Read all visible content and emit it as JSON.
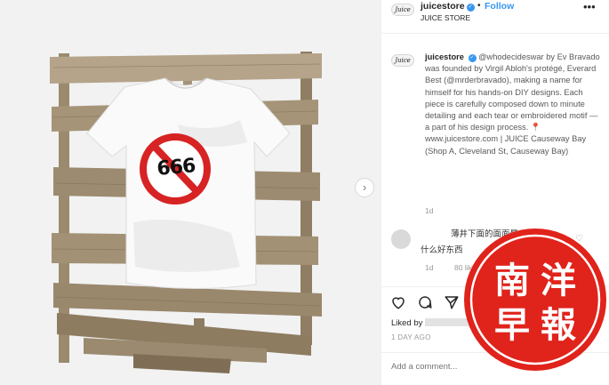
{
  "header": {
    "username": "juicestore",
    "verified_badge": "✓",
    "dot": "•",
    "follow_label": "Follow",
    "subtitle": "JUICE STORE",
    "more_label": "•••",
    "avatar_text": "Juice"
  },
  "caption": {
    "username": "juicestore",
    "text": "@whodecideswar by Ev Bravado was founded by Virgil Abloh's protégé, Everard Best (@mrderbravado), making a name for himself for his hands-on DIY designs. Each piece is carefully composed down to minute detailing and each tear or embroidered motif — a part of his design process.",
    "pin_icon": "📍",
    "text_after_pin": "www.juicestore.com | JUICE Causeway Bay (Shop A, Cleveland St, Causeway Bay)",
    "time": "1d"
  },
  "comment": {
    "line1": "薄井下面的面面景",
    "line2": "什么好东西",
    "time": "1d",
    "likes": "80 likes"
  },
  "likes": {
    "liked_by_label": "Liked by"
  },
  "post_time": "1 DAY AGO",
  "add_comment": {
    "placeholder": "Add a comment..."
  },
  "photo": {
    "shirt_number": "666",
    "carousel_next": "›"
  },
  "watermark": {
    "chars": [
      "南",
      "洋",
      "早",
      "報"
    ],
    "color": "#e0231b"
  },
  "icons": {
    "like": "heart-icon",
    "comment": "comment-icon",
    "share": "share-icon",
    "save": "bookmark-icon"
  }
}
